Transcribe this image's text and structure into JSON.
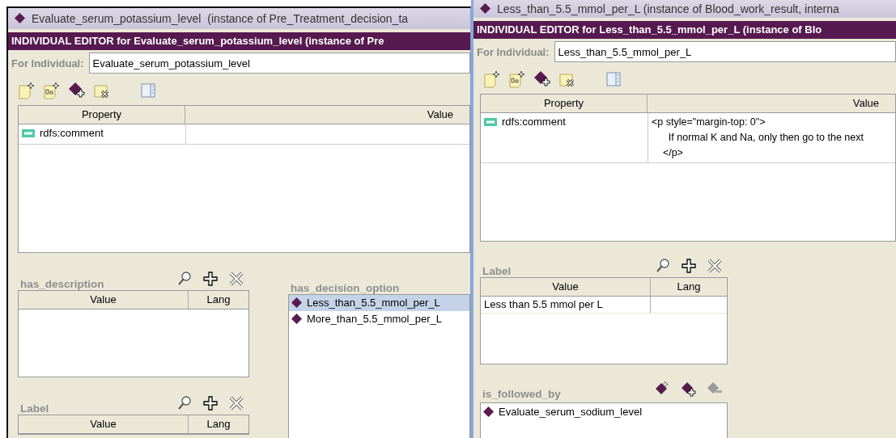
{
  "left_window": {
    "title": "Evaluate_serum_potassium_level",
    "title_suffix": "(instance of Pre_Treatment_decision_ta",
    "header": "INDIVIDUAL EDITOR for Evaluate_serum_potassium_level   (instance of Pre",
    "for_label": "For Individual:",
    "for_value": "Evaluate_serum_potassium_level",
    "property_table": {
      "columns": [
        "Property",
        "Value"
      ],
      "rows": [
        {
          "property": "rdfs:comment"
        }
      ]
    },
    "has_description": {
      "title": "has_description",
      "columns": [
        "Value",
        "Lang"
      ]
    },
    "label": {
      "title": "Label",
      "columns": [
        "Value",
        "Lang"
      ]
    },
    "has_decision_option": {
      "title": "has_decision_option",
      "items": [
        {
          "label": "Less_than_5.5_mmol_per_L",
          "selected": true
        },
        {
          "label": "More_than_5.5_mmol_per_L",
          "selected": false
        }
      ]
    }
  },
  "right_window": {
    "title": "Less_than_5.5_mmol_per_L   (instance of Blood_work_result, interna",
    "header": "INDIVIDUAL EDITOR for Less_than_5.5_mmol_per_L   (instance of Blo",
    "for_label": "For Individual:",
    "for_value": "Less_than_5.5_mmol_per_L",
    "property_table": {
      "columns": [
        "Property",
        "Value"
      ],
      "rows": [
        {
          "property": "rdfs:comment",
          "value": "<p style=\"margin-top: 0\">\n      If normal K and Na, only then go to the next\n    </p>"
        }
      ]
    },
    "label": {
      "title": "Label",
      "columns": [
        "Value",
        "Lang"
      ],
      "rows": [
        [
          "Less than 5.5 mmol per L"
        ]
      ]
    },
    "is_followed_by": {
      "title": "is_followed_by",
      "remove_disabled": true,
      "items": [
        {
          "label": "Evaluate_serum_sodium_level"
        }
      ]
    }
  }
}
